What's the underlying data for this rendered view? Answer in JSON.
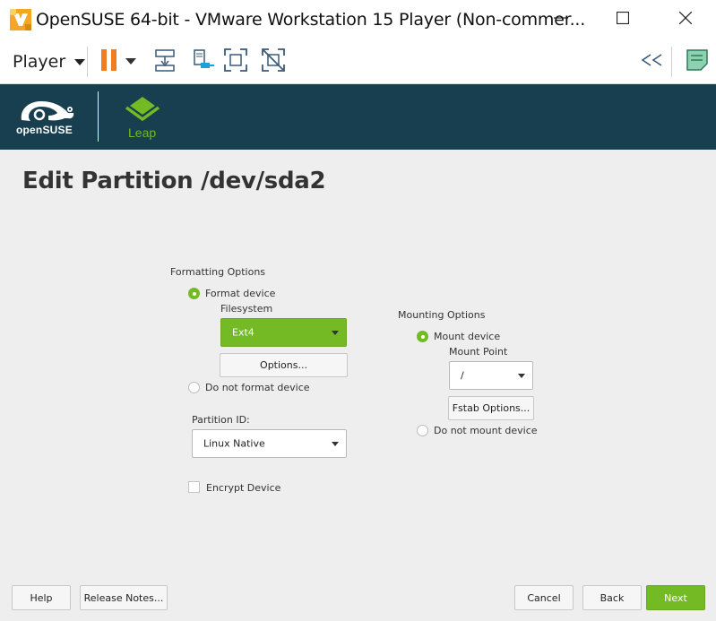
{
  "window": {
    "title": "OpenSUSE 64-bit - VMware Workstation 15 Player (Non-commer...",
    "controls": {
      "minimize": "minimize-icon",
      "maximize": "maximize-icon",
      "close": "close-icon"
    }
  },
  "toolbar": {
    "player_label": "Player",
    "icons": [
      "pause-icon",
      "send-keys-icon",
      "removable-devices-icon",
      "network-icon",
      "fullscreen-icon",
      "unity-icon",
      "collapse-left-icon",
      "notes-icon"
    ]
  },
  "header": {
    "brand": "openSUSE",
    "product": "Leap",
    "background": "#173f4f",
    "accent": "#73ba25"
  },
  "page": {
    "title": "Edit Partition /dev/sda2"
  },
  "formatting": {
    "section_label": "Formatting Options",
    "format_device_label": "Format device",
    "format_device_selected": true,
    "filesystem_label": "Filesystem",
    "filesystem_value": "Ext4",
    "options_button": "Options...",
    "do_not_format_label": "Do not format device",
    "partition_id_label": "Partition ID:",
    "partition_id_value": "Linux Native",
    "encrypt_label": "Encrypt Device",
    "encrypt_checked": false
  },
  "mounting": {
    "section_label": "Mounting Options",
    "mount_device_label": "Mount device",
    "mount_device_selected": true,
    "mount_point_label": "Mount Point",
    "mount_point_value": "/",
    "fstab_button": "Fstab Options...",
    "do_not_mount_label": "Do not mount device"
  },
  "footer": {
    "help": "Help",
    "release_notes": "Release Notes...",
    "cancel": "Cancel",
    "back": "Back",
    "next": "Next"
  }
}
